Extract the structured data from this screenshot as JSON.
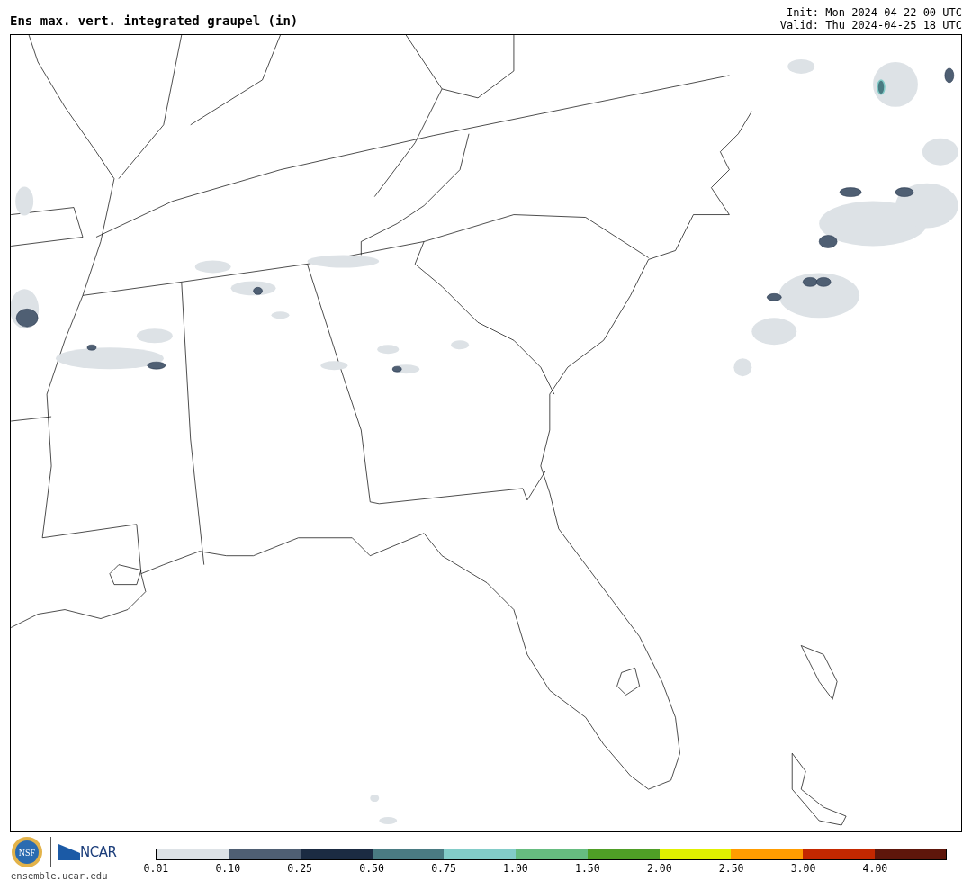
{
  "header": {
    "title": "Ens max. vert. integrated graupel (in)",
    "init": "Init: Mon 2024-04-22 00 UTC",
    "valid": "Valid: Thu 2024-04-25 18 UTC"
  },
  "footer": {
    "nsf_logo": "NSF",
    "ncar_logo": "NCAR",
    "site": "ensemble.ucar.edu"
  },
  "colorbar": [
    {
      "label": "0.01",
      "color": "#dde2e6"
    },
    {
      "label": "0.10",
      "color": "#4f5f73"
    },
    {
      "label": "0.25",
      "color": "#1b2b42"
    },
    {
      "label": "0.50",
      "color": "#4a7b82"
    },
    {
      "label": "0.75",
      "color": "#82ccc8"
    },
    {
      "label": "1.00",
      "color": "#66bc80"
    },
    {
      "label": "1.50",
      "color": "#4f9f26"
    },
    {
      "label": "2.00",
      "color": "#e0f000"
    },
    {
      "label": "2.50",
      "color": "#ff9c00"
    },
    {
      "label": "3.00",
      "color": "#c42800"
    },
    {
      "label": "4.00",
      "color": "#5e160b"
    }
  ]
}
